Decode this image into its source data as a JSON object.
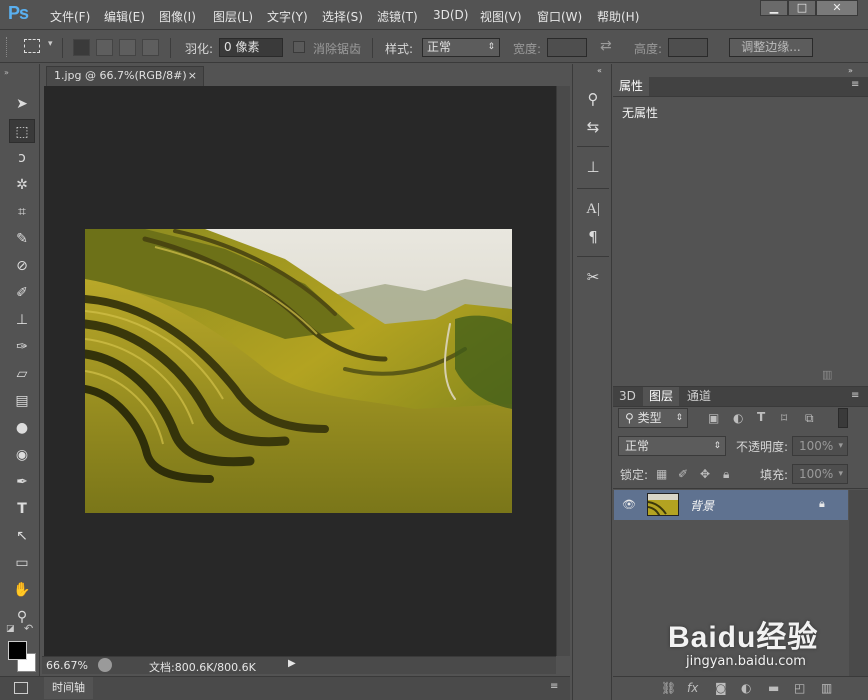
{
  "app": {
    "logo": "Ps"
  },
  "menu": [
    "文件(F)",
    "编辑(E)",
    "图像(I)",
    "图层(L)",
    "文字(Y)",
    "选择(S)",
    "滤镜(T)",
    "3D(D)",
    "视图(V)",
    "窗口(W)",
    "帮助(H)"
  ],
  "window_controls": {
    "minimize": "▁",
    "maximize": "□",
    "close": "✕"
  },
  "options": {
    "feather_label": "羽化:",
    "feather_value": "0 像素",
    "antialias_label": "消除锯齿",
    "style_label": "样式:",
    "style_value": "正常",
    "width_label": "宽度:",
    "height_label": "高度:",
    "refine_button": "调整边缘..."
  },
  "document": {
    "tab_title": "1.jpg @ 66.7%(RGB/8#)",
    "tab_close": "×",
    "zoom": "66.67%",
    "doc_info": "文档:800.6K/800.6K"
  },
  "timeline": {
    "label": "时间轴"
  },
  "properties": {
    "tab": "属性",
    "content": "无属性"
  },
  "layers": {
    "tabs": [
      "3D",
      "图层",
      "通道"
    ],
    "filter_kind": "类型",
    "blend_mode": "正常",
    "opacity_label": "不透明度:",
    "opacity_value": "100%",
    "lock_label": "锁定:",
    "fill_label": "填充:",
    "fill_value": "100%",
    "items": [
      {
        "name": "背景"
      }
    ]
  },
  "watermark": {
    "brand": "Baidu经验",
    "url": "jingyan.baidu.com"
  },
  "colors": {
    "accent": "#5ab0f0",
    "selected_layer": "#5f7290",
    "canvas_bg": "#282828"
  }
}
